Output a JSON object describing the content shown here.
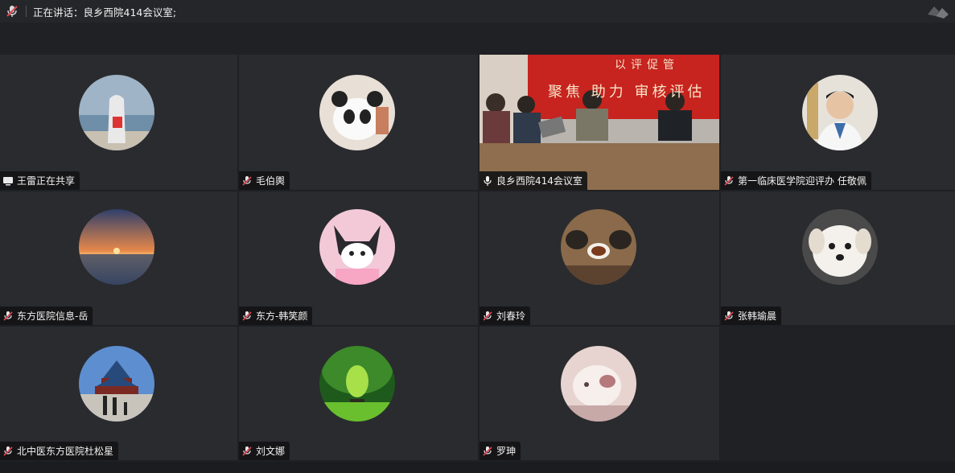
{
  "header": {
    "speaking_label": "正在讲话：",
    "speaking_name": "良乡西院414会议室;"
  },
  "participants": [
    {
      "name": "王雷正在共享",
      "status_icon": "screen-share-icon",
      "avatar": "beach-figure"
    },
    {
      "name": "毛伯輿",
      "status_icon": "mic-muted-icon",
      "avatar": "panda"
    },
    {
      "name": "良乡西院414会议室",
      "status_icon": "mic-active-icon",
      "avatar": "video",
      "video_banner": "聚焦 助力 审核评估",
      "video_top_text": "以评促管"
    },
    {
      "name": "第一临床医学院迎评办  任敬佩",
      "status_icon": "mic-muted-icon",
      "avatar": "doctor"
    },
    {
      "name": "东方医院信息-岳",
      "status_icon": "mic-muted-icon",
      "avatar": "sunset"
    },
    {
      "name": "东方-韩笑颜",
      "status_icon": "mic-muted-icon",
      "avatar": "kuromi"
    },
    {
      "name": "刘春玲",
      "status_icon": "mic-muted-icon",
      "avatar": "teaset"
    },
    {
      "name": "张韩瑜晨",
      "status_icon": "mic-muted-icon",
      "avatar": "dog"
    },
    {
      "name": "北中医东方医院杜松星",
      "status_icon": "mic-muted-icon",
      "avatar": "temple"
    },
    {
      "name": "刘文娜",
      "status_icon": "mic-muted-icon",
      "avatar": "forest"
    },
    {
      "name": "罗珅",
      "status_icon": "mic-muted-icon",
      "avatar": "cat"
    }
  ],
  "colors": {
    "active_border": "#2ecc71",
    "muted_red": "#e0454f",
    "tile_bg": "#2a2b2f"
  }
}
